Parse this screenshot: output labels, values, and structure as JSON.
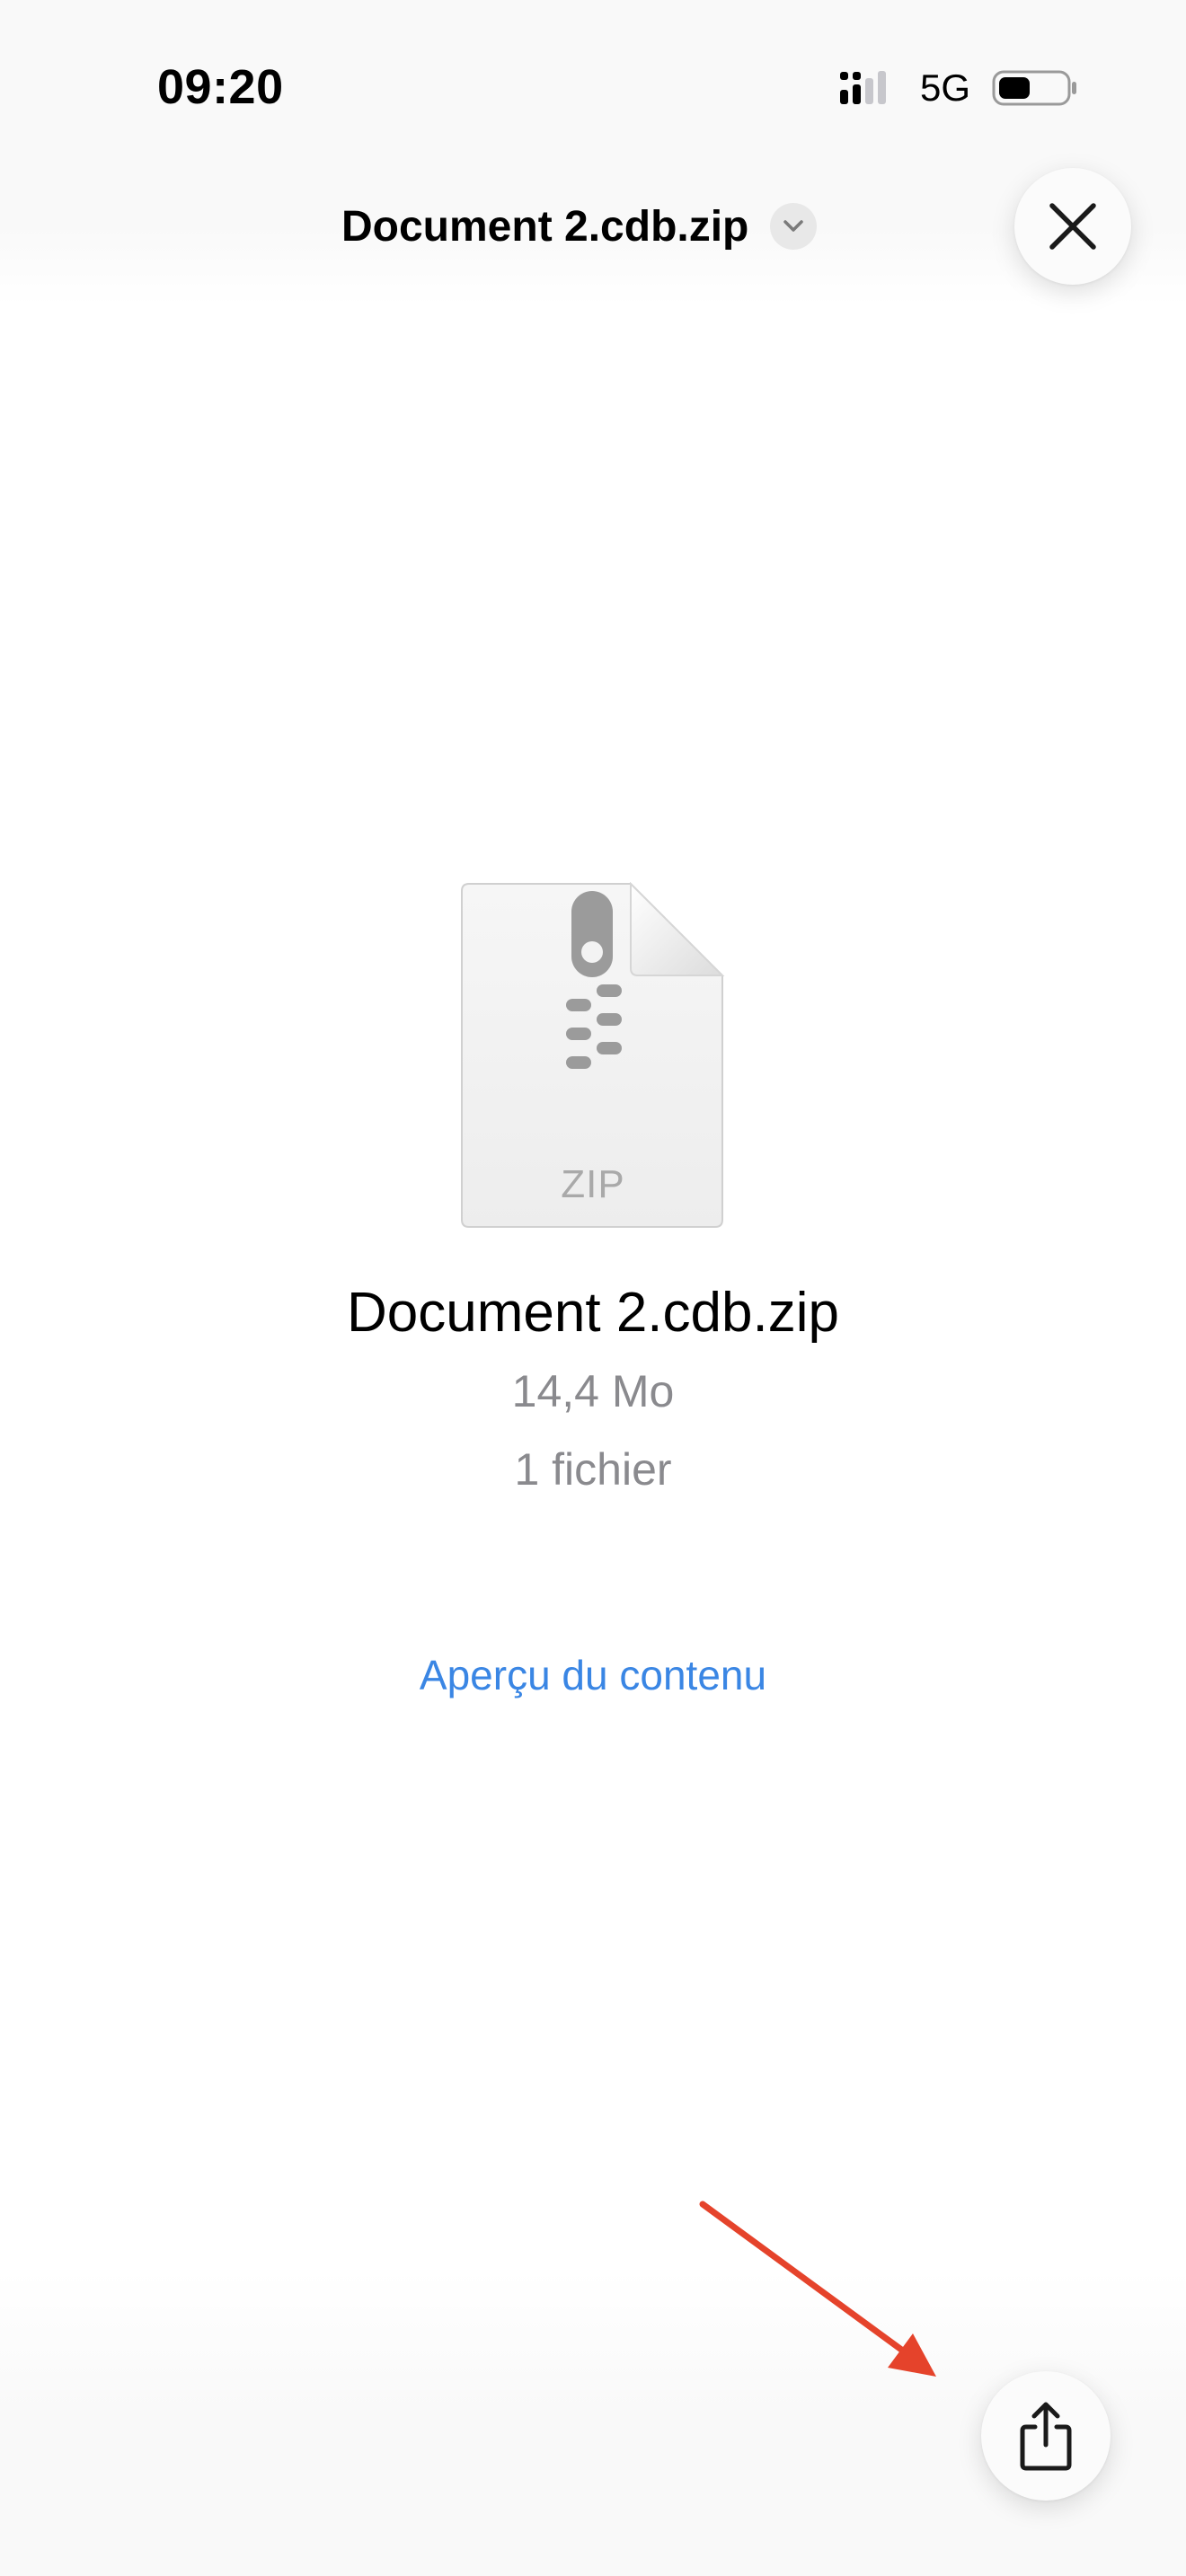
{
  "status_bar": {
    "time": "09:20",
    "network": "5G",
    "icons": [
      "signal-icon",
      "battery-icon"
    ]
  },
  "header": {
    "title": "Document 2.cdb.zip",
    "icons": [
      "chevron-down-icon",
      "close-icon"
    ]
  },
  "file": {
    "type_label": "ZIP",
    "name": "Document 2.cdb.zip",
    "size": "14,4 Mo",
    "count": "1 fichier",
    "icon": "zip-file-icon"
  },
  "actions": {
    "preview_link": "Aperçu du contenu",
    "share_icon": "share-icon"
  },
  "colors": {
    "link": "#3a86e4",
    "annotation_arrow": "#e5432b",
    "secondary_text": "#8a8a8e"
  }
}
